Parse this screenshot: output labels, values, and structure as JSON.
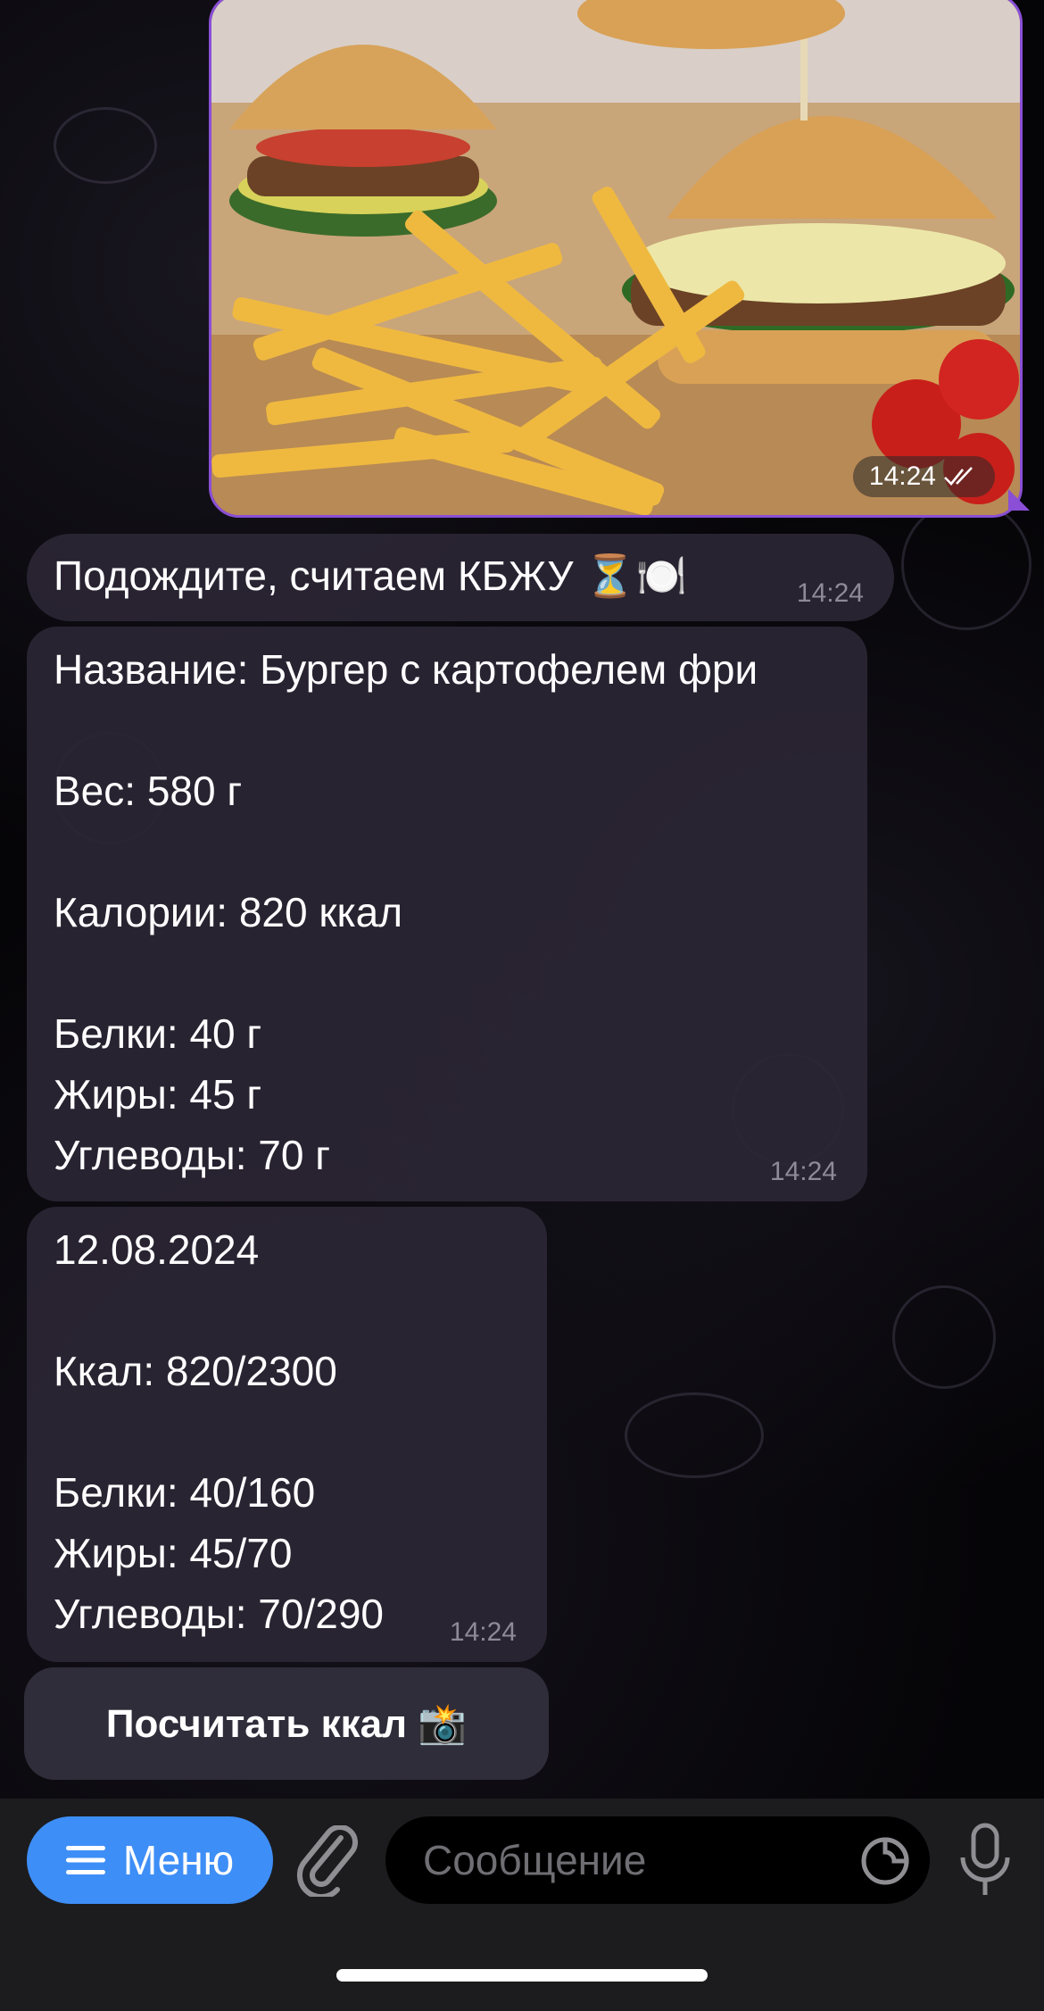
{
  "messages": {
    "photo": {
      "time": "14:24",
      "read_icon": "double-check-icon"
    },
    "waiting": {
      "text": "Подождите, считаем КБЖУ ⏳🍽️",
      "time": "14:24"
    },
    "analysis": {
      "name_line": "Название: Бургер с картофелем фри",
      "weight_line": "Вес: 580 г",
      "calories_line": "Калории: 820 ккал",
      "protein_line": "Белки: 40 г",
      "fat_line": "Жиры: 45 г",
      "carbs_line": "Углеводы: 70 г",
      "time": "14:24"
    },
    "daily": {
      "date_line": "12.08.2024",
      "kcal_line": "Ккал: 820/2300",
      "protein_line": "Белки: 40/160",
      "fat_line": "Жиры: 45/70",
      "carbs_line": "Углеводы: 70/290",
      "time": "14:24"
    }
  },
  "keyboard": {
    "count_button_label": "Посчитать ккал 📸"
  },
  "input_bar": {
    "menu_label": "Меню",
    "placeholder": "Сообщение"
  },
  "colors": {
    "accent": "#3e8ef7",
    "bubble_incoming": "#2b2634",
    "photo_border": "#8a4fd6"
  }
}
